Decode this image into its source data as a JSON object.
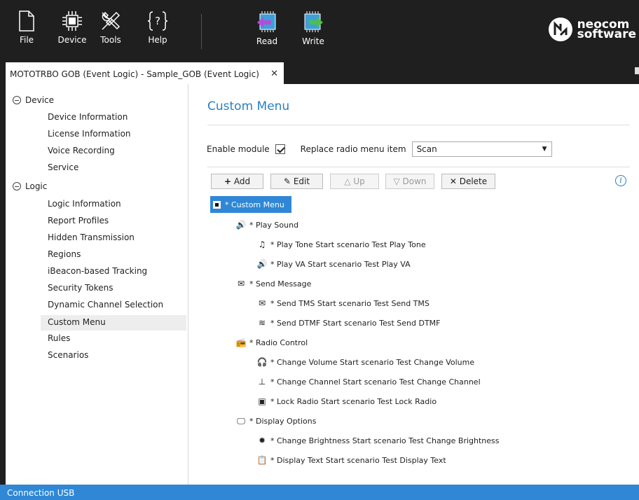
{
  "toolbar": {
    "file_label": "File",
    "device_label": "Device",
    "tools_label": "Tools",
    "help_label": "Help",
    "read_label": "Read",
    "write_label": "Write",
    "logo_line1": "neocom",
    "logo_line2": "software"
  },
  "tab": {
    "title": "MOTOTRBO GOB (Event Logic) - Sample_GOB (Event Logic)",
    "close": "✕"
  },
  "tree": {
    "device_group": "Device",
    "device_items": [
      "Device Information",
      "License Information",
      "Voice Recording",
      "Service"
    ],
    "logic_group": "Logic",
    "logic_items": [
      "Logic Information",
      "Report Profiles",
      "Hidden Transmission",
      "Regions",
      "iBeacon-based Tracking",
      "Security Tokens",
      "Dynamic Channel Selection",
      "Custom Menu",
      "Rules",
      "Scenarios"
    ],
    "selected": "Custom Menu"
  },
  "content": {
    "title": "Custom Menu",
    "enable_label": "Enable module",
    "enable_checked": true,
    "replace_label": "Replace radio menu item",
    "replace_value": "Scan",
    "buttons": {
      "add": "Add",
      "edit": "Edit",
      "up": "Up",
      "down": "Down",
      "delete": "Delete"
    },
    "menu": {
      "root": "* Custom Menu",
      "play_sound": "* Play Sound",
      "play_tone": "* Play Tone  Start scenario  Test Play Tone",
      "play_va": "* Play VA  Start scenario  Test Play VA",
      "send_message": "* Send Message",
      "send_tms": "* Send TMS  Start scenario  Test Send TMS",
      "send_dtmf": "* Send DTMF  Start scenario  Test Send DTMF",
      "radio_control": "* Radio Control",
      "change_volume": "* Change Volume  Start scenario  Test Change Volume",
      "change_channel": "* Change Channel  Start scenario  Test Change Channel",
      "lock_radio": "* Lock Radio  Start scenario  Test Lock Radio",
      "display_options": "* Display Options",
      "change_brightness": "* Change Brightness  Start scenario  Test Change Brightness",
      "display_text": "* Display Text  Start scenario  Test Display Text"
    }
  },
  "status": {
    "text": "Connection  USB"
  },
  "colors": {
    "accent": "#2f87d6",
    "title": "#2b7fc1",
    "toolbar_bg": "#1f1f1f"
  }
}
